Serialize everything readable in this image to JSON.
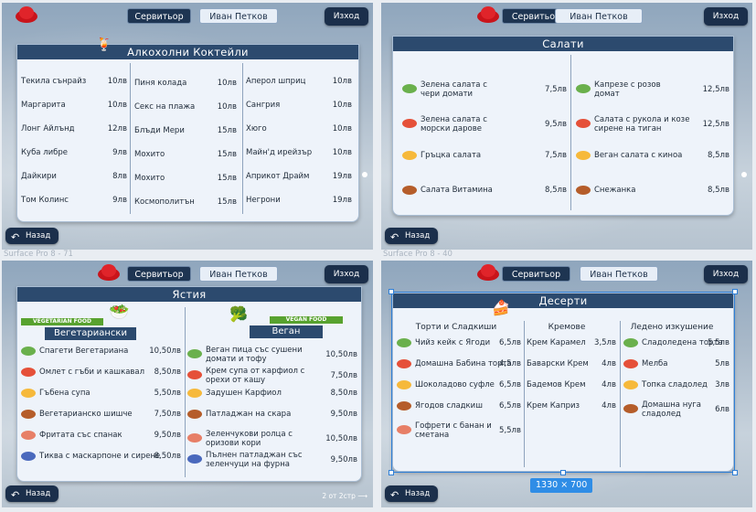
{
  "common": {
    "waiter_label": "Сервитьор",
    "waiter_name": "Иван Петков",
    "exit": "Изход",
    "back": "Назад"
  },
  "captions": {
    "s1": "Surface Pro 8 - 71",
    "s2": "Surface Pro 8 - 40"
  },
  "cocktails": {
    "title": "Алкохолни Коктейли",
    "col1": [
      {
        "n": "Текила сънрайз",
        "p": "10лв"
      },
      {
        "n": "Маргарита",
        "p": "10лв"
      },
      {
        "n": "Лонг Айлънд",
        "p": "12лв"
      },
      {
        "n": "Куба либре",
        "p": "9лв"
      },
      {
        "n": "Дайкири",
        "p": "8лв"
      },
      {
        "n": "Том Колинс",
        "p": "9лв"
      }
    ],
    "col2": [
      {
        "n": "Пиня колада",
        "p": "10лв"
      },
      {
        "n": "Секс на плажа",
        "p": "10лв"
      },
      {
        "n": "Блъди Мери",
        "p": "15лв"
      },
      {
        "n": "Мохито",
        "p": "15лв"
      },
      {
        "n": "Мохито",
        "p": "15лв"
      },
      {
        "n": "Космополитън",
        "p": "15лв"
      }
    ],
    "col3": [
      {
        "n": "Аперол шприц",
        "p": "10лв"
      },
      {
        "n": "Сангрия",
        "p": "10лв"
      },
      {
        "n": "Хюго",
        "p": "10лв"
      },
      {
        "n": "Майн'д ирейзър",
        "p": "10лв"
      },
      {
        "n": "Априкот Драйм",
        "p": "19лв"
      },
      {
        "n": "Негрони",
        "p": "19лв"
      }
    ]
  },
  "salads": {
    "title": "Салати",
    "col1": [
      {
        "n": "Зелена салата с\nчери домати",
        "p": "7,5лв"
      },
      {
        "n": "Зелена салата с\nморски дарове",
        "p": "9,5лв"
      },
      {
        "n": "Гръцка салата",
        "p": "7,5лв"
      },
      {
        "n": "Салата Витамина",
        "p": "8,5лв"
      }
    ],
    "col2": [
      {
        "n": "Капрезе с розов\nдомат",
        "p": "12,5лв"
      },
      {
        "n": "Салата с рукола и козе\nсирене на тиган",
        "p": "12,5лв"
      },
      {
        "n": "Веган салата с киноа",
        "p": "8,5лв"
      },
      {
        "n": "Снежанка",
        "p": "8,5лв"
      }
    ]
  },
  "dishes": {
    "title": "Ястия",
    "veg_banner": "VEGETARIAN FOOD",
    "vegan_banner": "VEGAN FOOD",
    "veg_title": "Вегетариански",
    "vegan_title": "Веган",
    "col1": [
      {
        "n": "Спагети Вегетариана",
        "p": "10,50лв"
      },
      {
        "n": "Омлет с гъби и кашкавал",
        "p": "8,50лв"
      },
      {
        "n": "Гъбена супа",
        "p": "5,50лв"
      },
      {
        "n": "Вегетарианско шишче",
        "p": "7,50лв"
      },
      {
        "n": "Фритата със спанак",
        "p": "9,50лв"
      },
      {
        "n": "Тиква с маскарпоне и сирене",
        "p": "8,50лв"
      }
    ],
    "col2": [
      {
        "n": "Веган пица със сушени\nдомати и тофу",
        "p": "10,50лв"
      },
      {
        "n": "Крем супа от карфиол с\nорехи от кашу",
        "p": "7,50лв"
      },
      {
        "n": "Задушен Карфиол",
        "p": "8,50лв"
      },
      {
        "n": "Патладжан на скара",
        "p": "9,50лв"
      },
      {
        "n": "Зеленчукови ролца с\nоризови кори",
        "p": "10,50лв"
      },
      {
        "n": "Пълнен патладжан със\nзеленчуци на фурна",
        "p": "9,50лв"
      }
    ],
    "pager": "2 от 2стр"
  },
  "desserts": {
    "title": "Десерти",
    "h1": "Торти и Сладкиши",
    "h2": "Кремове",
    "h3": "Ледено изкушение",
    "col1": [
      {
        "n": "Чийз кейк с Ягоди",
        "p": "6,5лв"
      },
      {
        "n": "Домашна Бабина торта",
        "p": "4,5лв"
      },
      {
        "n": "Шоколадово суфле",
        "p": "6,5лв"
      },
      {
        "n": "Ягодов сладкиш",
        "p": "6,5лв"
      },
      {
        "n": "Гофрети с банан и\nсметана",
        "p": "5,5лв"
      }
    ],
    "col2": [
      {
        "n": "Крем Карамел",
        "p": "3,5лв"
      },
      {
        "n": "Баварски Крем",
        "p": "4лв"
      },
      {
        "n": "Бадемов Крем",
        "p": "4лв"
      },
      {
        "n": "Крем Каприз",
        "p": "4лв"
      }
    ],
    "col3": [
      {
        "n": "Сладоледена торта",
        "p": "5,5лв"
      },
      {
        "n": "Мелба",
        "p": "5лв"
      },
      {
        "n": "Топка сладолед",
        "p": "3лв"
      },
      {
        "n": "Домашна нуга\nсладолед",
        "p": "6лв"
      }
    ],
    "dims": "1330 × 700"
  },
  "colors": {
    "header": "#2c4a6e",
    "button": "#1b2f4b",
    "accent": "#2f8de6"
  }
}
